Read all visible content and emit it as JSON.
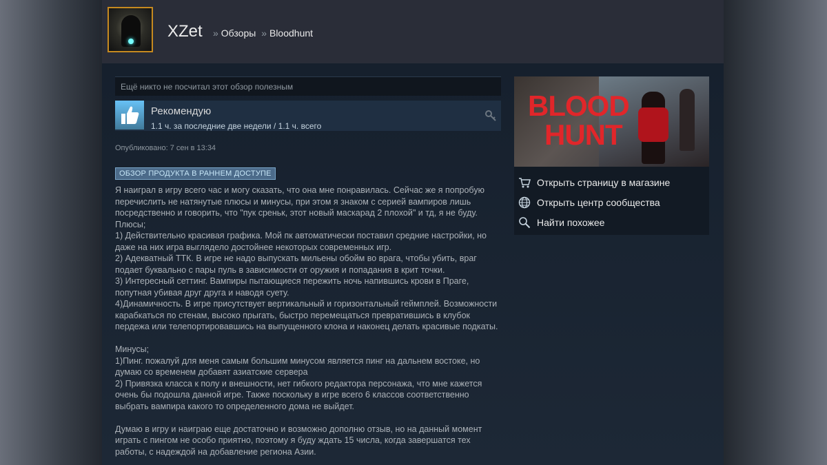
{
  "header": {
    "username": "XZet",
    "breadcrumb": {
      "separator": "»",
      "section": "Обзоры",
      "game": "Bloodhunt"
    }
  },
  "review": {
    "helpful_text": "Ещё никто не посчитал этот обзор полезным",
    "recommendation": "Рекомендую",
    "hours": "1.1 ч. за последние две недели / 1.1 ч. всего",
    "posted": "Опубликовано: 7 сен в 13:34",
    "early_access_badge": "ОБЗОР ПРОДУКТА В РАННЕМ ДОСТУПЕ",
    "lines": [
      "Я наиграл в игру всего час и могу сказать, что она мне понравилась. Сейчас же я попробую",
      "перечислить не натянутые плюсы и минусы, при этом я знаком с серией вампиров лишь",
      "посредственно и говорить, что \"пук среньк, этот новый маскарад 2 плохой\" и тд, я не буду.",
      "Плюсы;",
      "1) Действительно красивая графика. Мой пк автоматически поставил средние настройки, но",
      "даже на них игра выглядело достойнее некоторых современных игр.",
      "2) Адекватный ТТК. В игре не надо выпускать мильены обойм во врага, чтобы убить, враг",
      "подает буквально с пары пуль в зависимости от оружия и попадания в крит точки.",
      "3) Интересный сеттинг. Вампиры пытающиеся пережить ночь напившись крови в Праге,",
      "попутная убивая друг друга и наводя суету.",
      "4)Динамичность. В игре присутствует вертикальный и горизонтальный геймплей. Возможности",
      "карабкаться по стенам, высоко прыгать, быстро перемещаться превратившись в клубок",
      "пердежа или телепортировавшись на выпущенного клона и наконец делать красивые подкаты.",
      "",
      "Минусы;",
      "1)Пинг. пожалуй для меня самым большим минусом является пинг на дальнем востоке, но",
      "думаю со временем добавят азиатские сервера",
      "2) Привязка класса к полу и внешности, нет гибкого редактора персонажа, что мне кажется",
      "очень бы подошла данной игре. Также поскольку в игре всего 6 классов соответственно",
      "выбрать вампира какого то определенного дома не выйдет.",
      "",
      "Думаю в игру и наиграю еще достаточно и возможно дополню отзыв, но на данный момент",
      "играть с пингом не особо приятно, поэтому я буду ждать 15 числа, когда завершатся тех",
      "работы, с надеждой на добавление региона Азии."
    ]
  },
  "sidebar": {
    "capsule_logo": [
      "BLOOD",
      "HUNT"
    ],
    "links": [
      {
        "icon": "cart-icon",
        "label": "Открыть страницу в магазине"
      },
      {
        "icon": "globe-icon",
        "label": "Открыть центр сообщества"
      },
      {
        "icon": "magnifier-icon",
        "label": "Найти похожее"
      }
    ]
  }
}
